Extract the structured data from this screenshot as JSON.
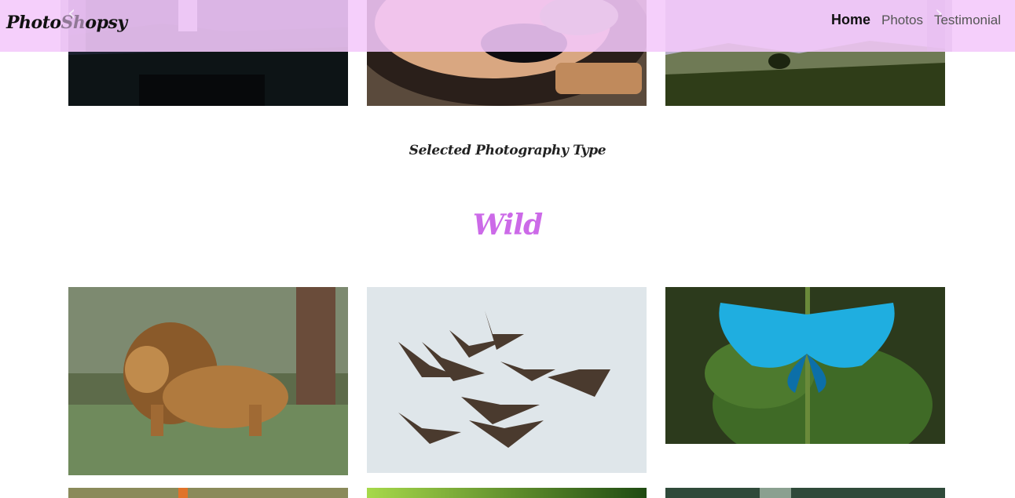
{
  "brand": {
    "name": "PhotoShopsy"
  },
  "nav": {
    "items": [
      {
        "label": "Home",
        "active": true
      },
      {
        "label": "Photos",
        "active": false
      },
      {
        "label": "Testimonial",
        "active": false
      }
    ]
  },
  "carousel": {
    "prev_icon": "chevron-left-icon",
    "next_icon": "chevron-right-icon"
  },
  "section": {
    "subtitle": "Selected Photography Type",
    "title": "Wild",
    "title_color": "#cc6ae8"
  },
  "colors": {
    "navbar": "#f4c8fa",
    "accent": "#cc6ae8"
  }
}
